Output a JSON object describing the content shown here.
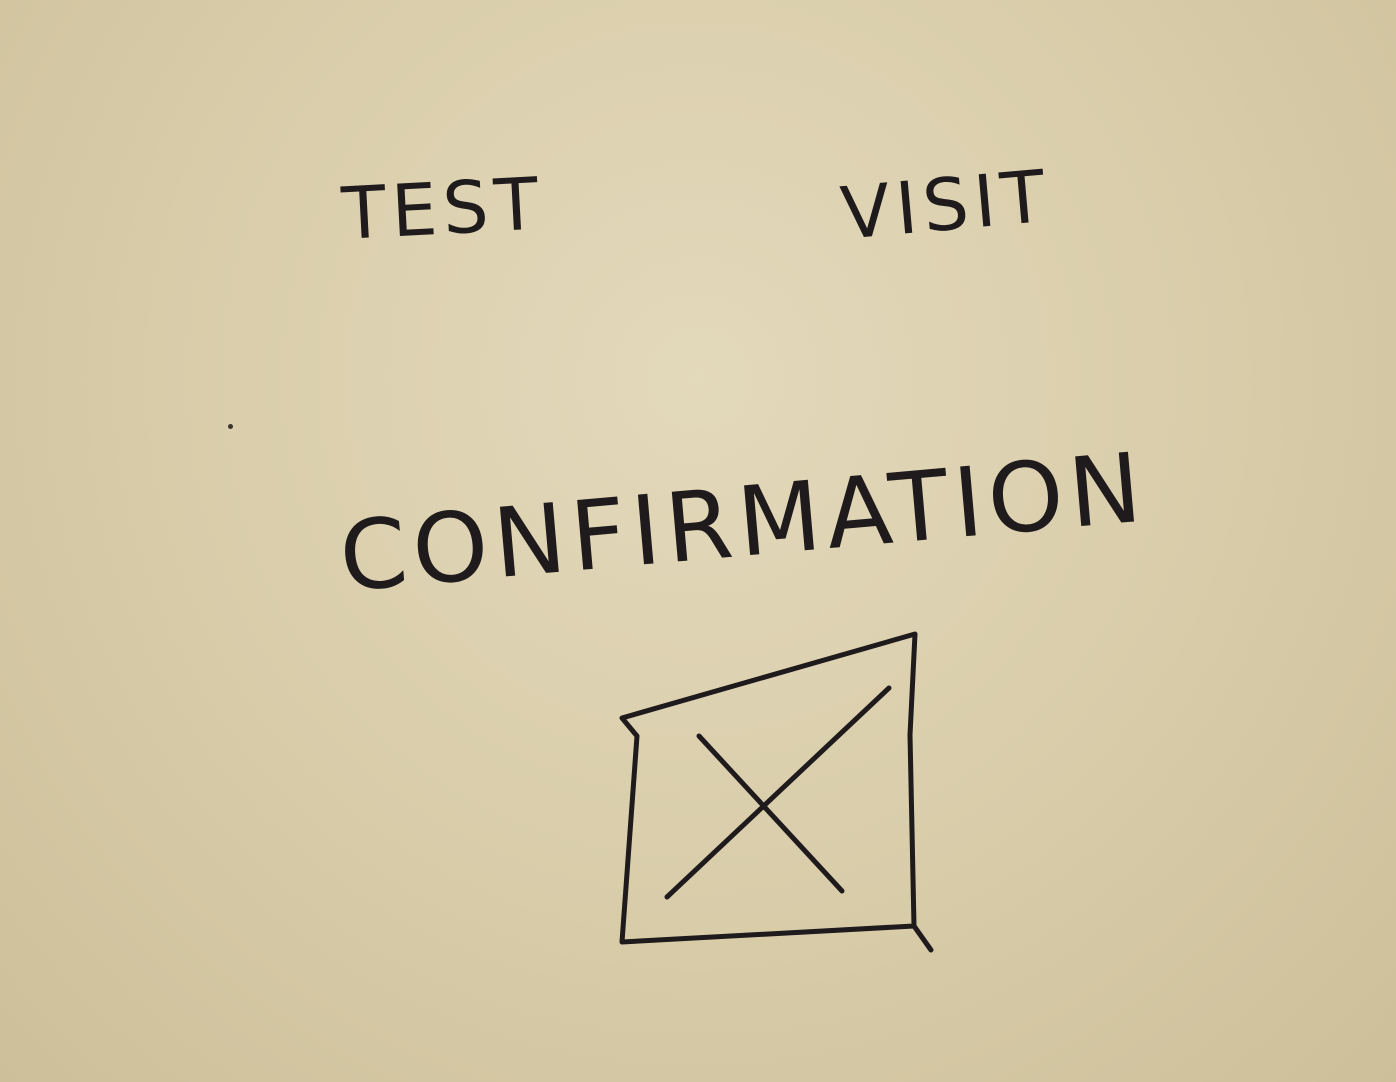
{
  "sketch": {
    "header_left": "TEST",
    "header_right": "VISIT",
    "confirmation_label": "CONFIRMATION"
  },
  "icons": {
    "placeholder": "image-placeholder-icon"
  },
  "colors": {
    "paper": "#dcd1b1",
    "ink": "#1f1a1c"
  }
}
